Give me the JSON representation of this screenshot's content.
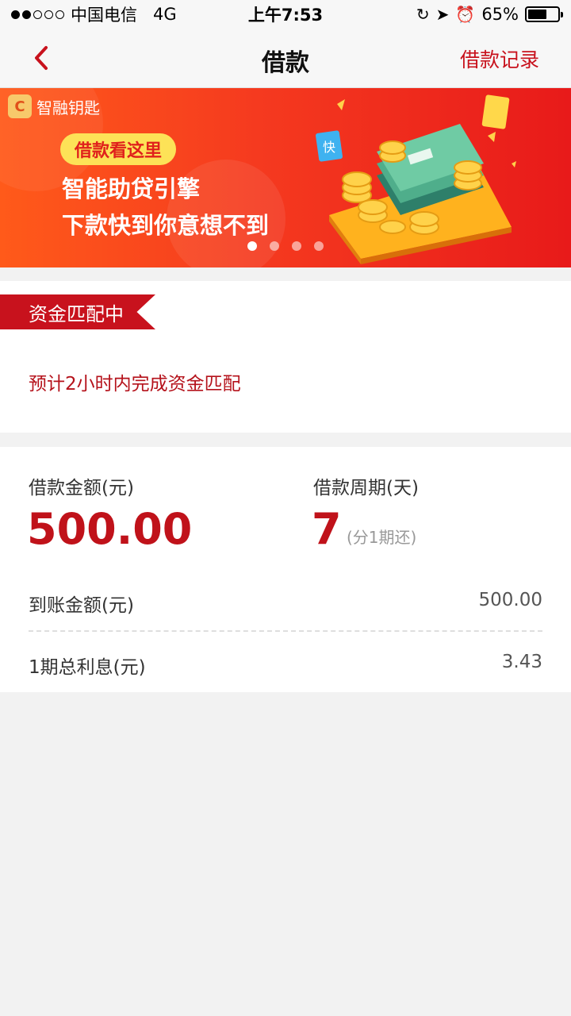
{
  "status_bar": {
    "carrier": "中国电信",
    "network": "4G",
    "time": "上午7:53",
    "battery": "65%",
    "battery_level": 0.65
  },
  "nav": {
    "title": "借款",
    "right_link": "借款记录"
  },
  "banner": {
    "brand": "智融钥匙",
    "tag": "借款看这里",
    "line1": "智能助贷引擎",
    "line2": "下款快到你意想不到",
    "page_count": 4,
    "active_page": 1
  },
  "status_card": {
    "badge": "资金匹配中",
    "message": "预计2小时内完成资金匹配"
  },
  "loan": {
    "amount_label": "借款金额(元)",
    "amount_value": "500.00",
    "period_label": "借款周期(天)",
    "period_value": "7",
    "period_note": "(分1期还)",
    "received_label": "到账金额(元)",
    "received_value": "500.00",
    "interest_label": "1期总利息(元)",
    "interest_value": "3.43"
  },
  "colors": {
    "accent": "#c8121d",
    "banner_start": "#ff5a1a",
    "banner_end": "#e81a1a",
    "tag_bg": "#fde257"
  }
}
